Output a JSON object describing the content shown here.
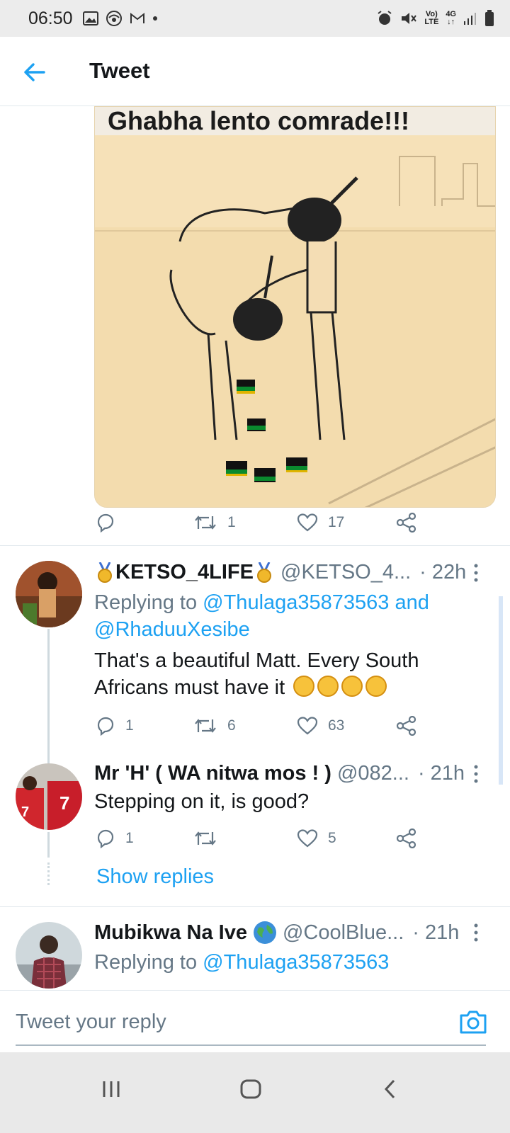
{
  "status_bar": {
    "time": "06:50",
    "left_icons": [
      "image-icon",
      "sound-icon",
      "gmail-icon",
      "dot-icon"
    ],
    "volte": "Vo)",
    "lte": "LTE",
    "network": "4G"
  },
  "header": {
    "title": "Tweet"
  },
  "media": {
    "caption": "Ghabha lento comrade!!!"
  },
  "main_tweet_actions": {
    "reply_count": "",
    "retweet_count": "1",
    "like_count": "17"
  },
  "replies": [
    {
      "display_name": "KETSO_4LIFE",
      "handle": "@KETSO_4...",
      "time": "· 22h",
      "replying_prefix": "Replying to ",
      "replying_to_1": "@Thulaga35873563",
      "replying_and": " and",
      "replying_to_2": "@RhaduuXesibe",
      "text_line1": "That's a beautiful Matt. Every South",
      "text_line2": "Africans must have it",
      "reply_count": "1",
      "retweet_count": "6",
      "like_count": "63"
    },
    {
      "display_name": "Mr 'H' ( WA nitwa mos ! )",
      "handle": "@082...",
      "time": "· 21h",
      "text_line1": "Stepping on it, is good?",
      "reply_count": "1",
      "retweet_count": "",
      "like_count": "5"
    },
    {
      "display_name": "Mubikwa Na Ive",
      "handle": "@CoolBlue...",
      "time": "· 21h",
      "replying_prefix": "Replying to ",
      "replying_to_1": "@Thulaga35873563"
    }
  ],
  "show_replies": "Show replies",
  "composer": {
    "placeholder": "Tweet your reply"
  },
  "colors": {
    "accent": "#1da1f2",
    "muted": "#657786",
    "divider": "#e1e8ed"
  }
}
